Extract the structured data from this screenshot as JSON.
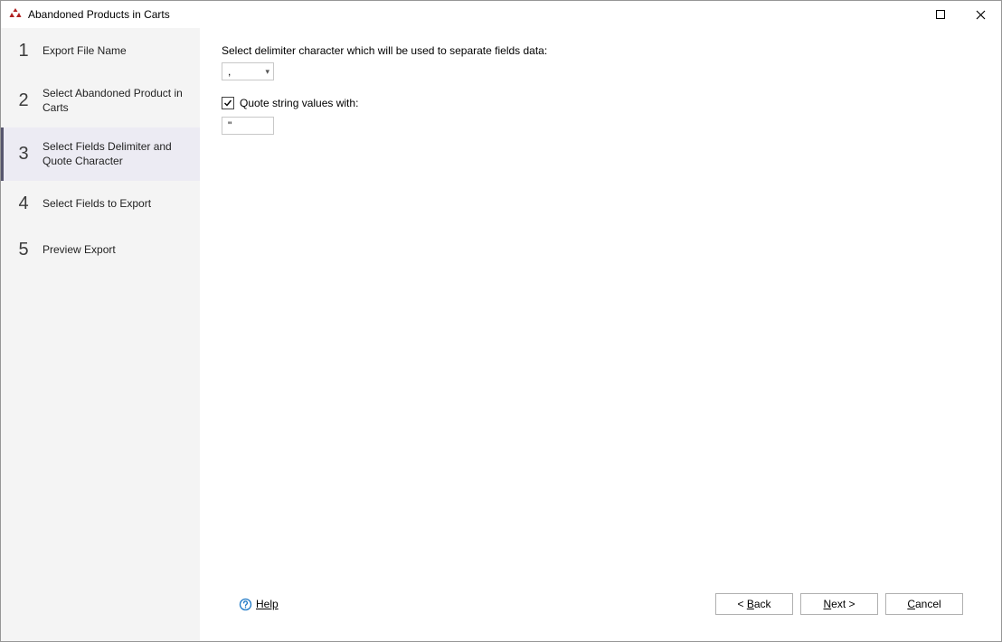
{
  "window": {
    "title": "Abandoned Products in Carts"
  },
  "sidebar": {
    "steps": [
      {
        "num": "1",
        "label": "Export File Name"
      },
      {
        "num": "2",
        "label": "Select Abandoned Product in Carts"
      },
      {
        "num": "3",
        "label": "Select Fields Delimiter and Quote Character"
      },
      {
        "num": "4",
        "label": "Select Fields to Export"
      },
      {
        "num": "5",
        "label": "Preview Export"
      }
    ],
    "active_index": 2
  },
  "main": {
    "delimiter_label": "Select delimiter character which will be used to separate fields data:",
    "delimiter_value": ",",
    "quote_checkbox_label": "Quote string values with:",
    "quote_checked": true,
    "quote_value": "\""
  },
  "footer": {
    "help_label": "Help",
    "back_label": "Back",
    "next_label": "Next",
    "cancel_label": "Cancel"
  }
}
